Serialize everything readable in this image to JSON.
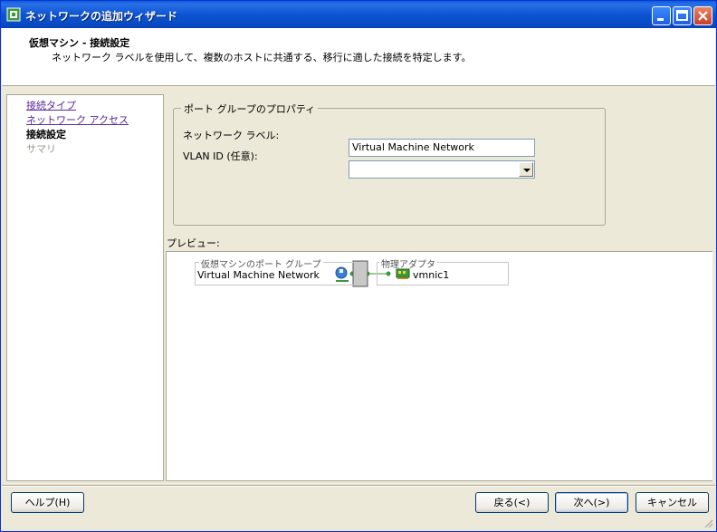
{
  "window": {
    "title": "ネットワークの追加ウィザード"
  },
  "header": {
    "title": "仮想マシン - 接続設定",
    "subtitle": "ネットワーク ラベルを使用して、複数のホストに共通する、移行に適した接続を特定します。"
  },
  "nav": {
    "items": [
      {
        "label": "接続タイプ",
        "state": "link"
      },
      {
        "label": "ネットワーク アクセス",
        "state": "link"
      },
      {
        "label": "接続設定",
        "state": "current"
      },
      {
        "label": "サマリ",
        "state": "disabled"
      }
    ]
  },
  "portgroup": {
    "legend": "ポート グループのプロパティ",
    "network_label_caption": "ネットワーク ラベル:",
    "network_label_value": "Virtual Machine Network",
    "vlan_caption": "VLAN ID (任意):",
    "vlan_value": ""
  },
  "preview": {
    "label": "プレビュー:",
    "vm_portgroup_legend": "仮想マシンのポート グループ",
    "vm_portgroup_name": "Virtual Machine Network",
    "physical_adapter_legend": "物理アダプタ",
    "physical_adapter_name": "vmnic1"
  },
  "buttons": {
    "help": "ヘルプ(H)",
    "back": "戻る(<)",
    "next": "次へ(>)",
    "cancel": "キャンセル"
  },
  "colors": {
    "titlebar": "#0a5fd8",
    "link": "#5b2a9b",
    "disabled": "#9c9a8c",
    "connector": "#3a9a3a"
  }
}
